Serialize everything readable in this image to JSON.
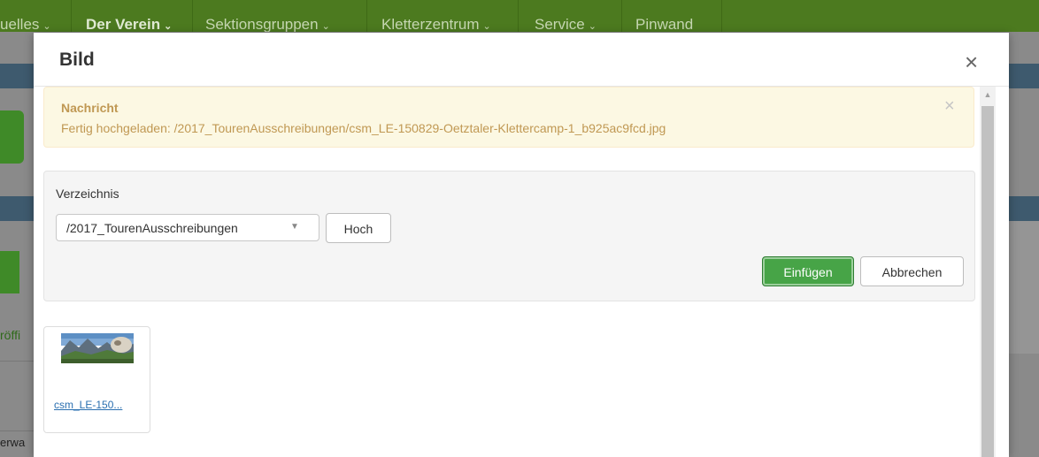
{
  "background_site": {
    "nav": [
      {
        "label": "uelles",
        "bold": false
      },
      {
        "label": "Der Verein",
        "bold": true
      },
      {
        "label": "Sektionsgruppen",
        "bold": false
      },
      {
        "label": "Kletterzentrum",
        "bold": false
      },
      {
        "label": "Service",
        "bold": false
      },
      {
        "label": "Pinwand",
        "bold": false
      }
    ],
    "nav_chevron": "⌄",
    "fragment_left_1": "röffi",
    "fragment_left_2": "erwa"
  },
  "modal": {
    "title": "Bild",
    "close_symbol": "×",
    "alert": {
      "title": "Nachricht",
      "message": "Fertig hochgeladen: /2017_TourenAusschreibungen/csm_LE-150829-Oetztaler-Klettercamp-1_b925ac9fcd.jpg",
      "close_symbol": "×"
    },
    "directory": {
      "label": "Verzeichnis",
      "selected": "/2017_TourenAusschreibungen",
      "up_button": "Hoch"
    },
    "actions": {
      "insert": "Einfügen",
      "cancel": "Abbrechen"
    },
    "files": [
      {
        "name": "csm_LE-150..."
      }
    ]
  },
  "colors": {
    "nav_green": "#4c7a1f",
    "alert_bg": "#fcf8e3",
    "alert_text": "#c09853",
    "primary_green": "#47a447",
    "link_blue": "#2a6fb0"
  },
  "icons": {
    "select_arrow": "caret-down-icon",
    "scroll_up": "scroll-up-arrow-icon"
  }
}
